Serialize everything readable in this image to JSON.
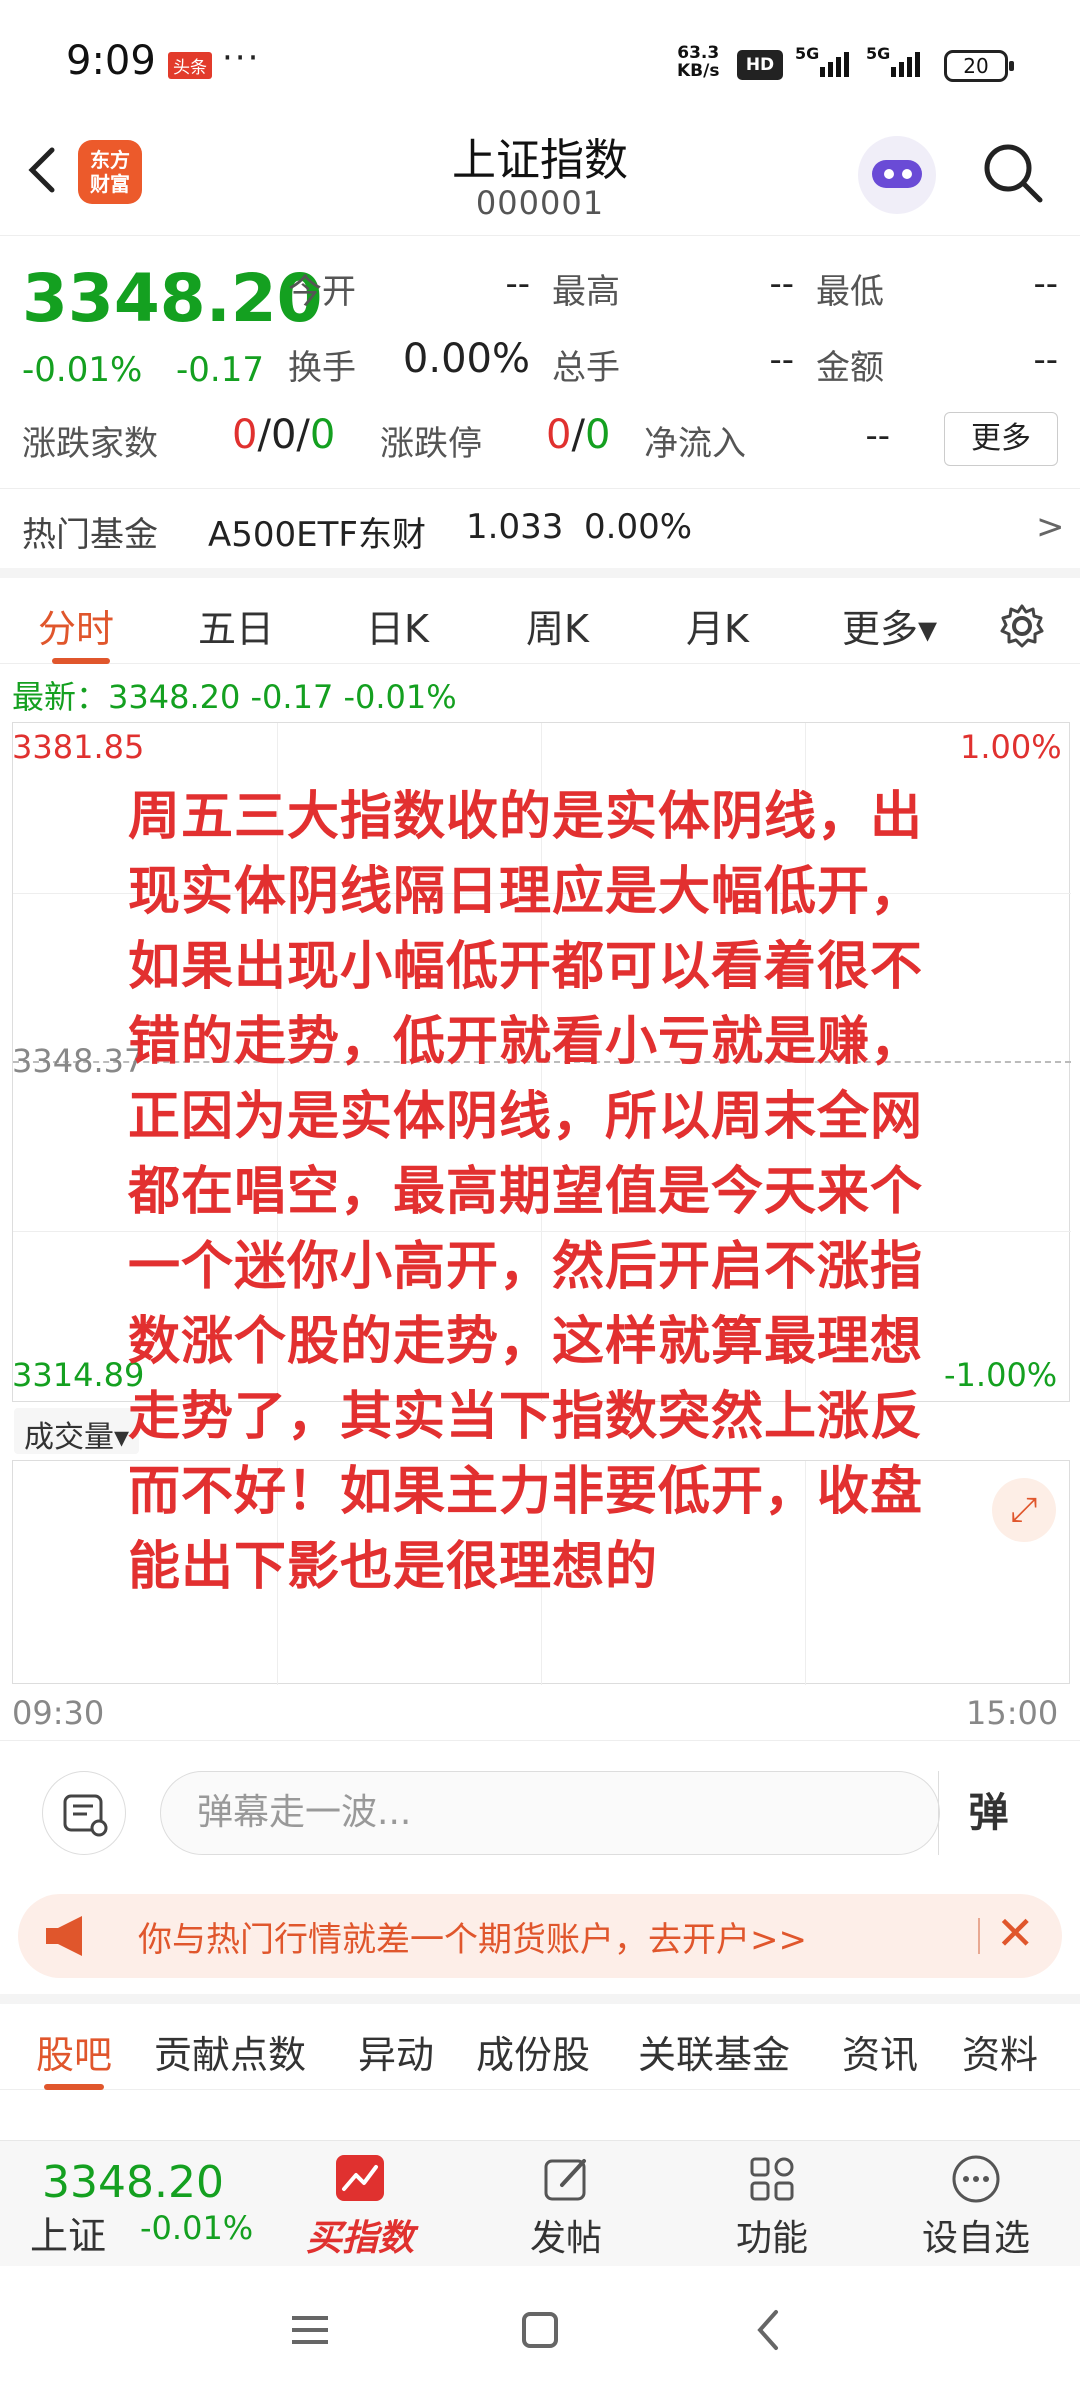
{
  "status": {
    "time": "9:09",
    "badge": "头条",
    "dots": "···",
    "speed_value": "63.3",
    "speed_unit": "KB/s",
    "hd": "HD",
    "net1": "5G",
    "net2": "5G",
    "battery": "20"
  },
  "header": {
    "logo_line1": "东方",
    "logo_line2": "财富",
    "title": "上证指数",
    "code": "000001"
  },
  "quote": {
    "price": "3348.20",
    "change_pct": "-0.01%",
    "change": "-0.17",
    "open_label": "今开",
    "open_value": "--",
    "high_label": "最高",
    "high_value": "--",
    "low_label": "最低",
    "low_value": "--",
    "turnover_label": "换手",
    "turnover_value": "0.00%",
    "volume_label": "总手",
    "volume_value": "--",
    "amount_label": "金额",
    "amount_value": "--",
    "updown_label": "涨跌家数",
    "updown_up": "0",
    "updown_flat": "0",
    "updown_down": "0",
    "limit_label": "涨跌停",
    "limit_up": "0",
    "limit_down": "0",
    "inflow_label": "净流入",
    "inflow_value": "--",
    "more_label": "更多",
    "slash": "/"
  },
  "fund": {
    "label": "热门基金",
    "name": "A500ETF东财",
    "price": "1.033",
    "pct": "0.00%",
    "arrow": ">"
  },
  "tabs": [
    "分时",
    "五日",
    "日K",
    "周K",
    "月K",
    "更多▾"
  ],
  "latest": "最新：3348.20  -0.17  -0.01%",
  "chart": {
    "upper_price": "3381.85",
    "mid_price": "3348.37",
    "lower_price": "3314.89",
    "upper_pct": "1.00%",
    "lower_pct": "-1.00%",
    "start_time": "09:30",
    "end_time": "15:00",
    "volume_tab": "成交量▾"
  },
  "overlay_text": "周五三大指数收的是实体阴线，出现实体阴线隔日理应是大幅低开，如果出现小幅低开都可以看着很不错的走势，低开就看小亏就是赚，正因为是实体阴线，所以周末全网都在唱空，最高期望值是今天来个一个迷你小高开，然后开启不涨指数涨个股的走势，这样就算最理想走势了，其实当下指数突然上涨反而不好！如果主力非要低开，收盘能出下影也是很理想的",
  "danmu": {
    "placeholder": "弹幕走一波...",
    "button": "弹"
  },
  "promo": {
    "text": "你与热门行情就差一个期货账户，去开户>>",
    "close": "✕"
  },
  "subtabs": [
    "股吧",
    "贡献点数",
    "异动",
    "成份股",
    "关联基金",
    "资讯",
    "资料"
  ],
  "bottombar": {
    "price": "3348.20",
    "name": "上证",
    "change_pct": "-0.01%",
    "buy": "买指数",
    "post": "发帖",
    "func": "功能",
    "watch": "设自选"
  },
  "colors": {
    "up": "#e0312f",
    "down": "#14a020",
    "accent": "#e0562c"
  }
}
